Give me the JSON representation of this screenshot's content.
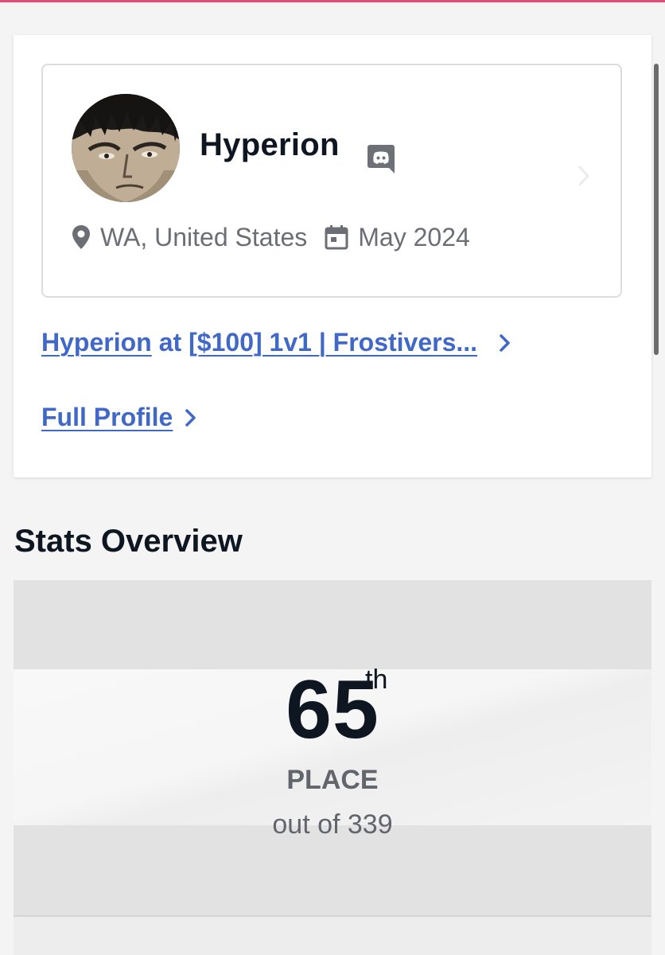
{
  "player": {
    "name": "Hyperion",
    "location": "WA, United States",
    "joined": "May 2024"
  },
  "event_link": {
    "player": "Hyperion",
    "connector": "at",
    "event": "[$100] 1v1 | Frostivers..."
  },
  "links": {
    "full_profile": "Full Profile"
  },
  "stats": {
    "section_title": "Stats Overview",
    "rank": "65",
    "rank_suffix": "th",
    "place_label": "PLACE",
    "out_of": "out of 339"
  },
  "colors": {
    "accent_top": "#e44d7b",
    "link": "#4068c8",
    "text_dark": "#0e1621",
    "text_muted": "#6b6e75"
  },
  "icons": {
    "location": "map-pin-icon",
    "calendar": "calendar-icon",
    "discord": "discord-icon",
    "chevron": "chevron-right-icon"
  }
}
